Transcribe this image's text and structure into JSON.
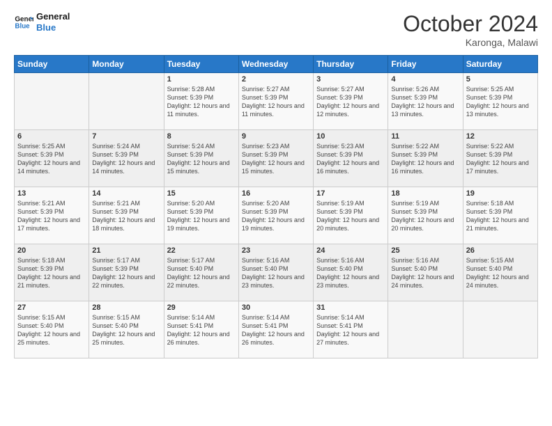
{
  "logo": {
    "line1": "General",
    "line2": "Blue"
  },
  "header": {
    "month_year": "October 2024",
    "location": "Karonga, Malawi"
  },
  "days_of_week": [
    "Sunday",
    "Monday",
    "Tuesday",
    "Wednesday",
    "Thursday",
    "Friday",
    "Saturday"
  ],
  "weeks": [
    [
      {
        "day": "",
        "info": ""
      },
      {
        "day": "",
        "info": ""
      },
      {
        "day": "1",
        "info": "Sunrise: 5:28 AM\nSunset: 5:39 PM\nDaylight: 12 hours and 11 minutes."
      },
      {
        "day": "2",
        "info": "Sunrise: 5:27 AM\nSunset: 5:39 PM\nDaylight: 12 hours and 11 minutes."
      },
      {
        "day": "3",
        "info": "Sunrise: 5:27 AM\nSunset: 5:39 PM\nDaylight: 12 hours and 12 minutes."
      },
      {
        "day": "4",
        "info": "Sunrise: 5:26 AM\nSunset: 5:39 PM\nDaylight: 12 hours and 13 minutes."
      },
      {
        "day": "5",
        "info": "Sunrise: 5:25 AM\nSunset: 5:39 PM\nDaylight: 12 hours and 13 minutes."
      }
    ],
    [
      {
        "day": "6",
        "info": "Sunrise: 5:25 AM\nSunset: 5:39 PM\nDaylight: 12 hours and 14 minutes."
      },
      {
        "day": "7",
        "info": "Sunrise: 5:24 AM\nSunset: 5:39 PM\nDaylight: 12 hours and 14 minutes."
      },
      {
        "day": "8",
        "info": "Sunrise: 5:24 AM\nSunset: 5:39 PM\nDaylight: 12 hours and 15 minutes."
      },
      {
        "day": "9",
        "info": "Sunrise: 5:23 AM\nSunset: 5:39 PM\nDaylight: 12 hours and 15 minutes."
      },
      {
        "day": "10",
        "info": "Sunrise: 5:23 AM\nSunset: 5:39 PM\nDaylight: 12 hours and 16 minutes."
      },
      {
        "day": "11",
        "info": "Sunrise: 5:22 AM\nSunset: 5:39 PM\nDaylight: 12 hours and 16 minutes."
      },
      {
        "day": "12",
        "info": "Sunrise: 5:22 AM\nSunset: 5:39 PM\nDaylight: 12 hours and 17 minutes."
      }
    ],
    [
      {
        "day": "13",
        "info": "Sunrise: 5:21 AM\nSunset: 5:39 PM\nDaylight: 12 hours and 17 minutes."
      },
      {
        "day": "14",
        "info": "Sunrise: 5:21 AM\nSunset: 5:39 PM\nDaylight: 12 hours and 18 minutes."
      },
      {
        "day": "15",
        "info": "Sunrise: 5:20 AM\nSunset: 5:39 PM\nDaylight: 12 hours and 19 minutes."
      },
      {
        "day": "16",
        "info": "Sunrise: 5:20 AM\nSunset: 5:39 PM\nDaylight: 12 hours and 19 minutes."
      },
      {
        "day": "17",
        "info": "Sunrise: 5:19 AM\nSunset: 5:39 PM\nDaylight: 12 hours and 20 minutes."
      },
      {
        "day": "18",
        "info": "Sunrise: 5:19 AM\nSunset: 5:39 PM\nDaylight: 12 hours and 20 minutes."
      },
      {
        "day": "19",
        "info": "Sunrise: 5:18 AM\nSunset: 5:39 PM\nDaylight: 12 hours and 21 minutes."
      }
    ],
    [
      {
        "day": "20",
        "info": "Sunrise: 5:18 AM\nSunset: 5:39 PM\nDaylight: 12 hours and 21 minutes."
      },
      {
        "day": "21",
        "info": "Sunrise: 5:17 AM\nSunset: 5:39 PM\nDaylight: 12 hours and 22 minutes."
      },
      {
        "day": "22",
        "info": "Sunrise: 5:17 AM\nSunset: 5:40 PM\nDaylight: 12 hours and 22 minutes."
      },
      {
        "day": "23",
        "info": "Sunrise: 5:16 AM\nSunset: 5:40 PM\nDaylight: 12 hours and 23 minutes."
      },
      {
        "day": "24",
        "info": "Sunrise: 5:16 AM\nSunset: 5:40 PM\nDaylight: 12 hours and 23 minutes."
      },
      {
        "day": "25",
        "info": "Sunrise: 5:16 AM\nSunset: 5:40 PM\nDaylight: 12 hours and 24 minutes."
      },
      {
        "day": "26",
        "info": "Sunrise: 5:15 AM\nSunset: 5:40 PM\nDaylight: 12 hours and 24 minutes."
      }
    ],
    [
      {
        "day": "27",
        "info": "Sunrise: 5:15 AM\nSunset: 5:40 PM\nDaylight: 12 hours and 25 minutes."
      },
      {
        "day": "28",
        "info": "Sunrise: 5:15 AM\nSunset: 5:40 PM\nDaylight: 12 hours and 25 minutes."
      },
      {
        "day": "29",
        "info": "Sunrise: 5:14 AM\nSunset: 5:41 PM\nDaylight: 12 hours and 26 minutes."
      },
      {
        "day": "30",
        "info": "Sunrise: 5:14 AM\nSunset: 5:41 PM\nDaylight: 12 hours and 26 minutes."
      },
      {
        "day": "31",
        "info": "Sunrise: 5:14 AM\nSunset: 5:41 PM\nDaylight: 12 hours and 27 minutes."
      },
      {
        "day": "",
        "info": ""
      },
      {
        "day": "",
        "info": ""
      }
    ]
  ]
}
